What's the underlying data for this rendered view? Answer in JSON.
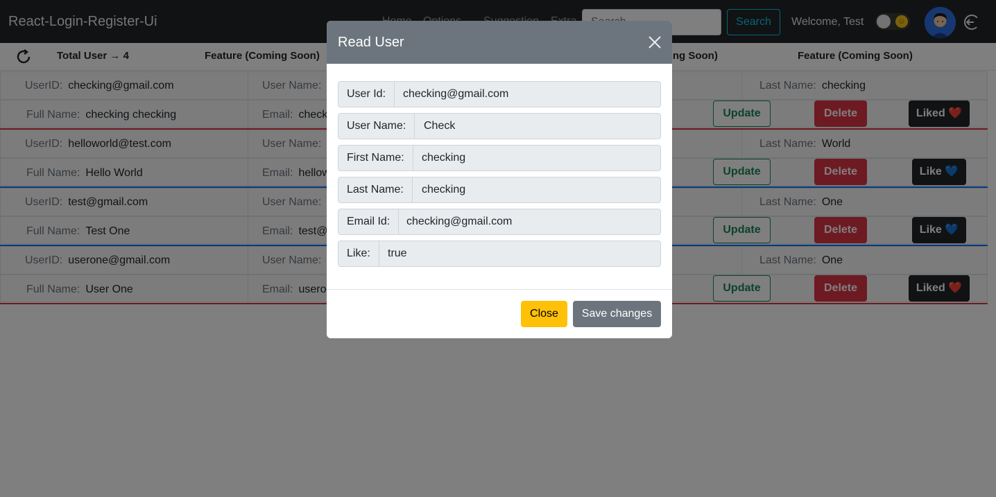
{
  "navbar": {
    "brand": "React-Login-Register-Ui",
    "links": [
      "Home",
      "Options",
      "Suggestion",
      "Extra"
    ],
    "search_placeholder": "Search",
    "search_button": "Search",
    "welcome": "Welcome, Test"
  },
  "subheader": {
    "total_users": "Total User → 4",
    "feature_1": "Feature (Coming Soon)",
    "feature_2": "Feature (Coming Soon)",
    "feature_3": "Feature (Coming Soon)"
  },
  "labels": {
    "user_id": "UserID:",
    "user_name": "User Name:",
    "last_name": "Last Name:",
    "full_name": "Full Name:",
    "email": "Email:",
    "update": "Update",
    "delete": "Delete"
  },
  "users": [
    {
      "user_id": "checking@gmail.com",
      "user_name_partial": "",
      "last_name": "checking",
      "full_name": "checking checking",
      "email_partial": "check",
      "like_label": "Liked ❤️",
      "sep_color": "#dc3545"
    },
    {
      "user_id": "helloworld@test.com",
      "user_name_partial": "",
      "last_name": "World",
      "full_name": "Hello World",
      "email_partial": "hellow",
      "like_label": "Like 💙",
      "sep_color": "#0d6efd"
    },
    {
      "user_id": "test@gmail.com",
      "user_name_partial": "",
      "last_name": "One",
      "full_name": "Test One",
      "email_partial": "test@",
      "like_label": "Like 💙",
      "sep_color": "#0d6efd"
    },
    {
      "user_id": "userone@gmail.com",
      "user_name_partial": "",
      "last_name": "One",
      "full_name": "User One",
      "email_partial": "usero",
      "like_label": "Liked ❤️",
      "sep_color": "#dc3545"
    }
  ],
  "modal": {
    "title": "Read User",
    "fields": [
      {
        "label": "User Id:",
        "value": "checking@gmail.com"
      },
      {
        "label": "User Name:",
        "value": "Check"
      },
      {
        "label": "First Name:",
        "value": "checking"
      },
      {
        "label": "Last Name:",
        "value": "checking"
      },
      {
        "label": "Email Id:",
        "value": "checking@gmail.com"
      },
      {
        "label": "Like:",
        "value": "true"
      }
    ],
    "close_label": "Close",
    "save_label": "Save changes"
  },
  "colors": {
    "navbar_bg": "#212529",
    "modal_header_bg": "#6c757d",
    "close_btn": "#ffc107",
    "update_green": "#198754",
    "delete_red": "#dc3545"
  }
}
